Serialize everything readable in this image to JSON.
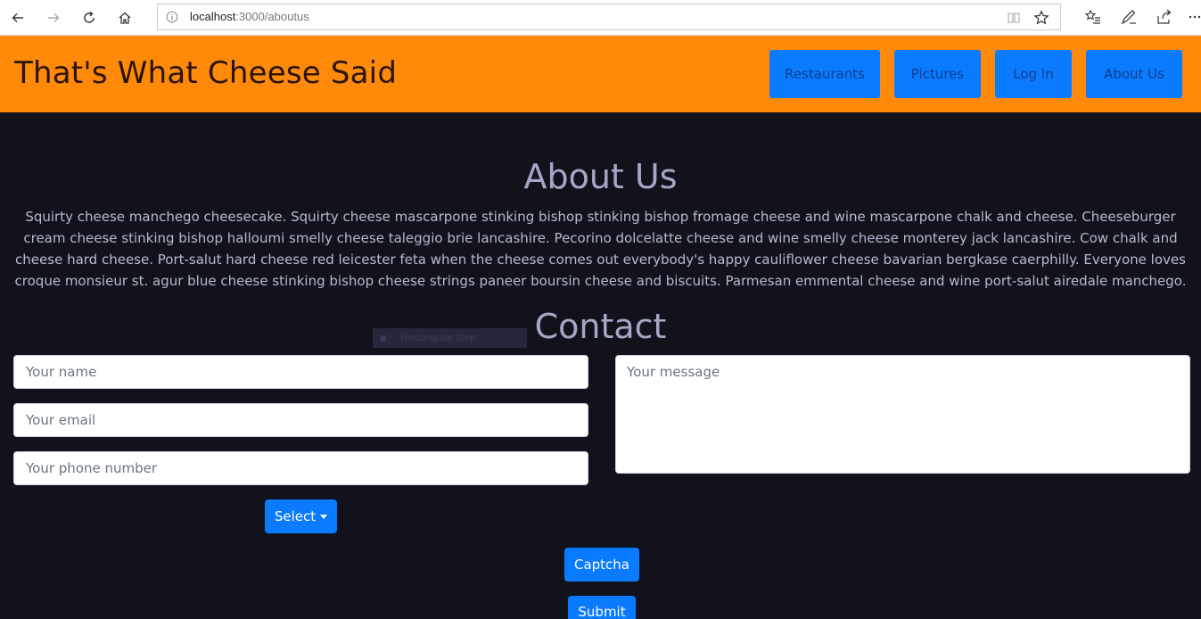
{
  "browser": {
    "url_host": "localhost",
    "url_rest": ":3000/aboutus"
  },
  "header": {
    "brand": "That's What Cheese Said",
    "nav": [
      {
        "label": "Restaurants"
      },
      {
        "label": "Pictures"
      },
      {
        "label": "Log In"
      },
      {
        "label": "About Us"
      }
    ]
  },
  "about": {
    "title": "About Us",
    "body": "Squirty cheese manchego cheesecake. Squirty cheese mascarpone stinking bishop stinking bishop fromage cheese and wine mascarpone chalk and cheese. Cheeseburger cream cheese stinking bishop halloumi smelly cheese taleggio brie lancashire. Pecorino dolcelatte cheese and wine smelly cheese monterey jack lancashire. Cow chalk and cheese hard cheese. Port-salut hard cheese red leicester feta when the cheese comes out everybody's happy cauliflower cheese bavarian bergkase caerphilly. Everyone loves croque monsieur st. agur blue cheese stinking bishop cheese strings paneer boursin cheese and biscuits. Parmesan emmental cheese and wine port-salut airedale manchego."
  },
  "contact": {
    "title": "Contact",
    "snip_label": "Rectangular Snip",
    "name_placeholder": "Your name",
    "email_placeholder": "Your email",
    "phone_placeholder": "Your phone number",
    "message_placeholder": "Your message",
    "select_label": "Select",
    "captcha_label": "Captcha",
    "submit_label": "Submit"
  },
  "colors": {
    "header_bg": "#ff8a0a",
    "page_bg": "#12121c",
    "button": "#0a7bff",
    "heading": "#a4a7c6"
  }
}
